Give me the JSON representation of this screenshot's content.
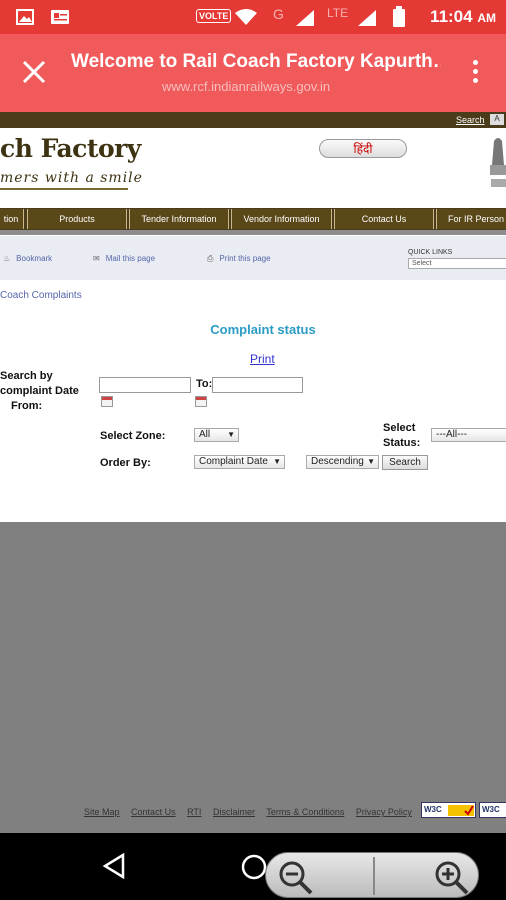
{
  "status_bar": {
    "time": "11:04",
    "ampm": "AM",
    "network_badge": "VOLTE",
    "network_g": "G",
    "network_lte": "LTE"
  },
  "header": {
    "title": "Welcome to Rail Coach Factory Kapurth…",
    "url": "www.rcf.indianrailways.gov.in"
  },
  "site": {
    "top_search": "Search",
    "top_a": "A",
    "brand": "ch Factory",
    "tagline": "mers with a smile",
    "hindi_button": "हिंदी",
    "nav": [
      "tion",
      "Products",
      "Tender Information",
      "Vendor Information",
      "Contact Us",
      "For IR Person"
    ],
    "tools": {
      "bookmark": "Bookmark",
      "mail": "Mail this page",
      "print": "Print this page"
    },
    "quick_links_label": "QUICK LINKS",
    "quick_links_value": "Select"
  },
  "form": {
    "breadcrumb": "Coach Complaints",
    "heading": "Complaint status",
    "print_link": "Print",
    "search_by_l1": "Search by",
    "search_by_l2": "complaint Date",
    "search_by_l3": "From:",
    "to_label": "To:",
    "from_value": "",
    "to_value": "",
    "zone_label": "Select Zone:",
    "zone_value": "All",
    "status_label_l1": "Select",
    "status_label_l2": "Status:",
    "status_value": "---All---",
    "order_label": "Order By:",
    "order_value": "Complaint Date",
    "direction_value": "Descending",
    "search_button": "Search"
  },
  "footer": {
    "links": [
      "Site Map",
      "Contact Us",
      "RTI",
      "Disclaimer",
      "Terms & Conditions",
      "Privacy Policy"
    ],
    "badge1": "W3C",
    "badge2": "W3C"
  },
  "colors": {
    "status_bar": "#e53935",
    "header": "#f05a5a",
    "site_brown": "#4a3b1a",
    "heading": "#2a9bc4"
  }
}
